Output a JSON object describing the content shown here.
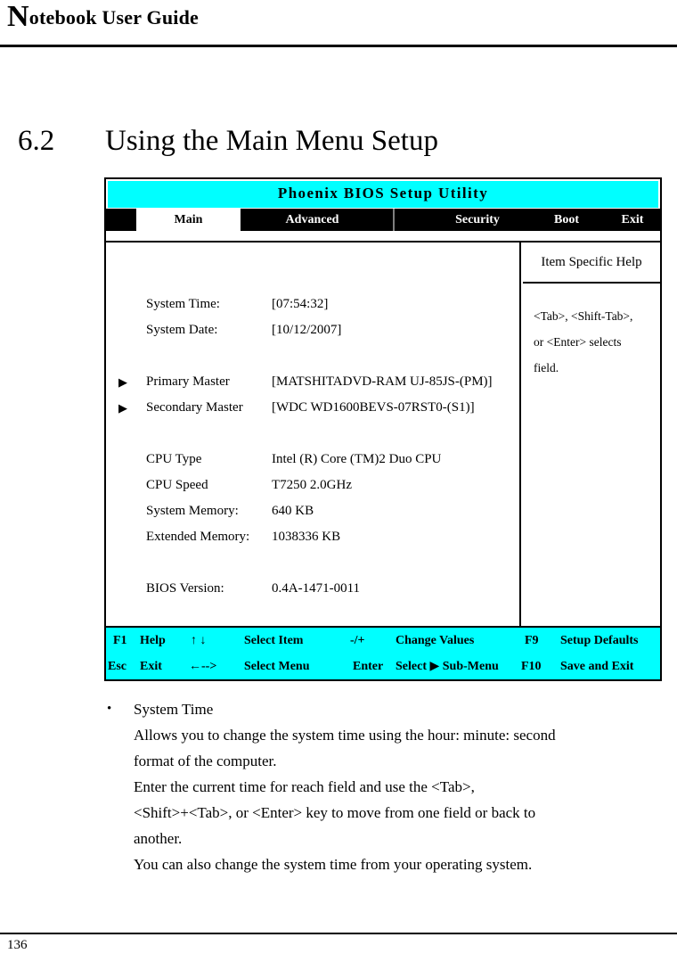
{
  "header": {
    "title_dropcap": "N",
    "title_rest": "otebook User Guide"
  },
  "section": {
    "number": "6.2",
    "title": "Using the Main Menu Setup"
  },
  "bios": {
    "title": "Phoenix BIOS Setup Utility",
    "accent_color": "#00FFFF",
    "tabs": [
      {
        "label": "Main",
        "active": true
      },
      {
        "label": "Advanced",
        "active": false
      },
      {
        "label": "Security",
        "active": false
      },
      {
        "label": "Boot",
        "active": false
      },
      {
        "label": "Exit",
        "active": false
      }
    ],
    "settings": [
      {
        "marker": "",
        "label": "System Time:",
        "value": "[07:54:32]"
      },
      {
        "marker": "",
        "label": "System Date:",
        "value": "[10/12/2007]"
      },
      {
        "marker": "▶",
        "label": "Primary Master",
        "value": "[MATSHITADVD-RAM UJ-85JS-(PM)]"
      },
      {
        "marker": "▶",
        "label": "Secondary Master",
        "value": "[WDC WD1600BEVS-07RST0-(S1)]"
      },
      {
        "marker": "",
        "label": "CPU Type",
        "value": "Intel (R) Core (TM)2 Duo CPU"
      },
      {
        "marker": "",
        "label": "CPU Speed",
        "value": "T7250   2.0GHz"
      },
      {
        "marker": "",
        "label": "System Memory:",
        "value": "640 KB"
      },
      {
        "marker": "",
        "label": "Extended Memory:",
        "value": "1038336 KB"
      },
      {
        "marker": "",
        "label": "BIOS Version:",
        "value": "0.4A-1471-0011"
      }
    ],
    "help": {
      "header": "Item Specific Help",
      "line1": "<Tab>, <Shift-Tab>,",
      "line2": "or <Enter> selects",
      "line3": "field."
    },
    "legend": {
      "row1": [
        {
          "key": "F1",
          "action": "Help"
        },
        {
          "key": "↑ ↓",
          "action": "Select Item"
        },
        {
          "key": "-/+",
          "action": "Change Values"
        },
        {
          "key": "F9",
          "action": "Setup Defaults"
        }
      ],
      "row2": [
        {
          "key": "Esc",
          "action": "Exit"
        },
        {
          "key": "←-->",
          "action": "Select Menu"
        },
        {
          "key": "Enter",
          "action": "Select ▶ Sub-Menu"
        },
        {
          "key": "F10",
          "action": "Save and Exit"
        }
      ]
    }
  },
  "prose": {
    "bullet_glyph": "•",
    "heading": "System Time",
    "lines": [
      "Allows you to change the system time using the hour: minute: second",
      "format of the computer.",
      "Enter the current time for reach field and use the <Tab>,",
      "<Shift>+<Tab>, or <Enter> key to move from one field or back to",
      "another.",
      "You can also change the system time from your operating system."
    ]
  },
  "footer": {
    "page_number": "136"
  }
}
